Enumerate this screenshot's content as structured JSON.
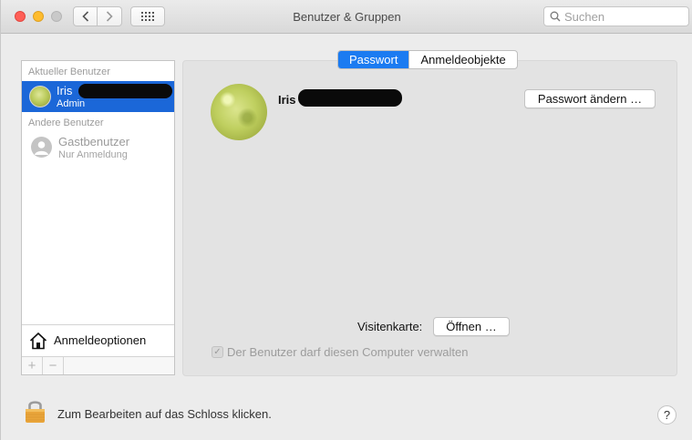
{
  "window": {
    "title": "Benutzer & Gruppen"
  },
  "search": {
    "placeholder": "Suchen"
  },
  "sidebar": {
    "current_users_label": "Aktueller Benutzer",
    "current_user": {
      "name": "Iris",
      "role": "Admin"
    },
    "other_users_label": "Andere Benutzer",
    "guest_user": {
      "name": "Gastbenutzer",
      "role": "Nur Anmeldung"
    },
    "login_options_label": "Anmeldeoptionen",
    "add_label": "+",
    "remove_label": "−"
  },
  "tabs": [
    {
      "label": "Passwort",
      "active": true
    },
    {
      "label": "Anmeldeobjekte",
      "active": false
    }
  ],
  "profile": {
    "name": "Iris",
    "change_password_label": "Passwort ändern …"
  },
  "contact_card": {
    "label": "Visitenkarte:",
    "open_label": "Öffnen …"
  },
  "admin_checkbox": {
    "label": "Der Benutzer darf diesen Computer verwalten",
    "checked": true,
    "check_glyph": "✓",
    "enabled": false
  },
  "footer": {
    "lock_text": "Zum Bearbeiten auf das Schloss klicken.",
    "help_label": "?"
  },
  "colors": {
    "selection_blue": "#1b67d8",
    "tab_active_blue": "#1b7bf1",
    "lock_gold": "#e9a53a"
  }
}
